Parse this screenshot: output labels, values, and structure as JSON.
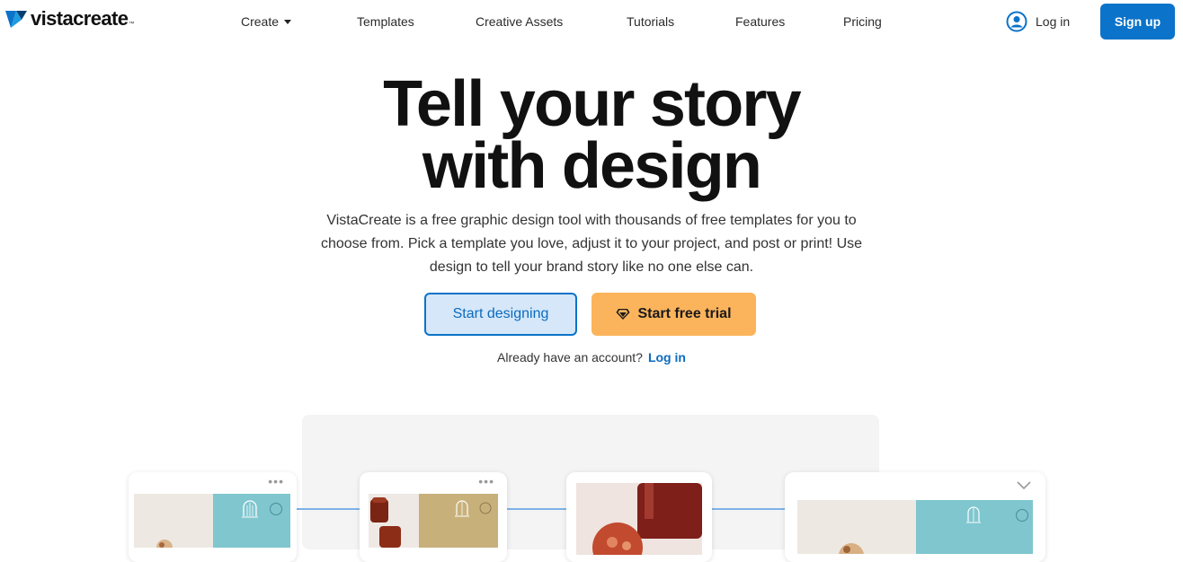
{
  "nav": {
    "logo_text": "vistacreate",
    "logo_tm": "™",
    "items": [
      "Create",
      "Templates",
      "Creative Assets",
      "Tutorials",
      "Features",
      "Pricing"
    ],
    "login": "Log in",
    "signup": "Sign up"
  },
  "hero": {
    "title_line1": "Tell your story",
    "title_line2": "with design",
    "subtitle_line1": "VistaCreate is a free graphic design tool with thousands of free templates for you to",
    "subtitle_line2": "choose from. Pick a template you love, adjust it to your project, and post or print! Use",
    "subtitle_line3": "design to tell your brand story like no one else can.",
    "btn_design": "Start designing",
    "btn_trial": "Start free trial",
    "account_text": "Already have an account?",
    "account_link": "Log in"
  },
  "preview": {
    "cards": [
      {
        "menu": "•••"
      },
      {
        "menu": "•••"
      },
      {},
      {
        "menu": "chevron-down-icon"
      }
    ]
  },
  "colors": {
    "brand_blue": "#0b73c9",
    "trial_orange": "#fbb45c",
    "teal": "#7fc6cf",
    "tan": "#c8b07a"
  }
}
